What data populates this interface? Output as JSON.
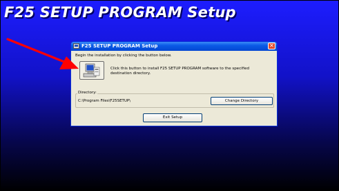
{
  "background": {
    "title": "F25 SETUP PROGRAM Setup"
  },
  "dialog": {
    "title": "F25 SETUP PROGRAM Setup",
    "intro_text": "Begin the installation by clicking the button below.",
    "install_description": "Click this button to install F25 SETUP PROGRAM software to the specified destination directory.",
    "directory_label": "Directory:",
    "directory_path": "C:\\Program Files\\F25SETUP\\",
    "change_directory_label": "Change Directory",
    "exit_label": "Exit Setup",
    "icons": {
      "app": "setup-app-icon",
      "close": "close-icon",
      "install": "computer-setup-icon",
      "annotation": "red-arrow-icon"
    }
  },
  "colors": {
    "desktop_top": "#1d1dff",
    "desktop_bottom": "#000000",
    "dialog_face": "#ece9d8",
    "titlebar": "#0a5ae6",
    "arrow": "#ff0000"
  }
}
